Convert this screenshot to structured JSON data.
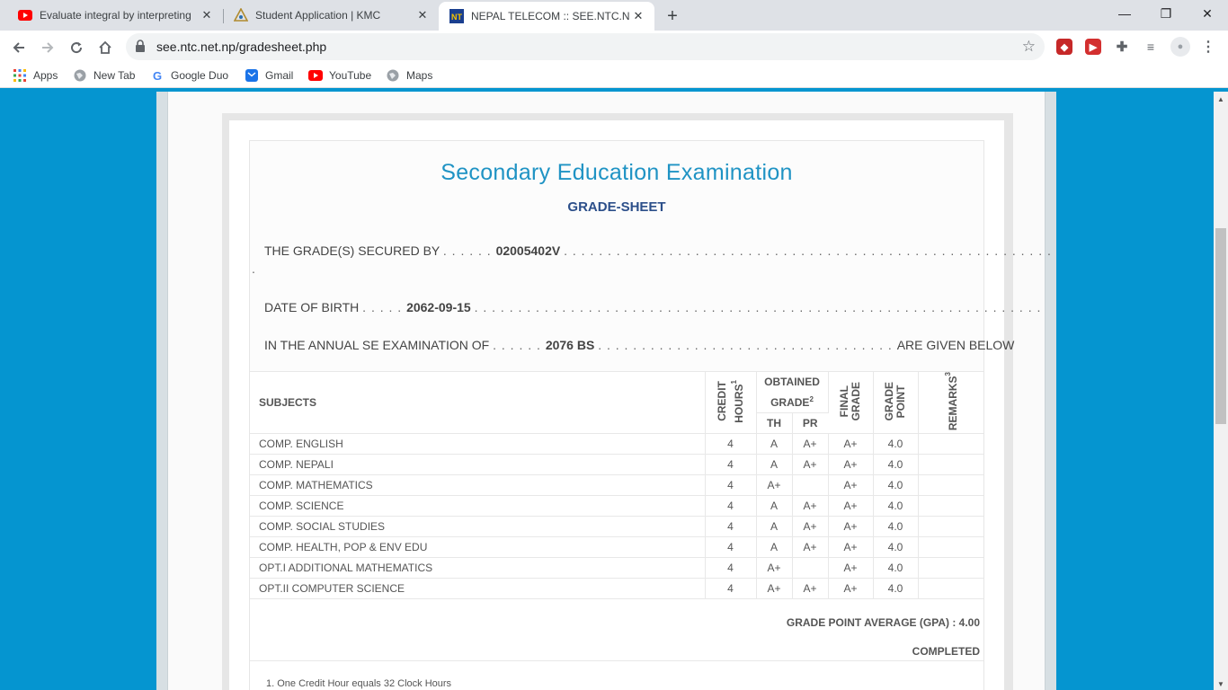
{
  "tabs": [
    {
      "title": "Evaluate integral by interpreting",
      "icon": "youtube-icon"
    },
    {
      "title": "Student Application | KMC",
      "icon": "kmc-logo-icon"
    },
    {
      "title": "NEPAL TELECOM :: SEE.NTC.NET.",
      "icon": "ntc-logo-icon"
    }
  ],
  "address_bar": {
    "url": "see.ntc.net.np/gradesheet.php"
  },
  "bookmarks": [
    {
      "label": "Apps",
      "icon": "apps-grid-icon"
    },
    {
      "label": "New Tab",
      "icon": "globe-icon"
    },
    {
      "label": "Google Duo",
      "icon": "google-icon"
    },
    {
      "label": "Gmail",
      "icon": "gmail-icon"
    },
    {
      "label": "YouTube",
      "icon": "youtube-icon"
    },
    {
      "label": "Maps",
      "icon": "globe-icon"
    }
  ],
  "sheet": {
    "title": "Secondary Education Examination",
    "subtitle": "GRADE-SHEET",
    "secured_by_label": "THE GRADE(S) SECURED BY",
    "secured_by_value": "02005402V",
    "dob_label": "DATE OF BIRTH",
    "dob_value": "2062-09-15",
    "exam_label": "IN THE ANNUAL SE EXAMINATION OF",
    "exam_value": "2076 BS",
    "exam_suffix": "ARE GIVEN BELOW"
  },
  "table": {
    "headers": {
      "subjects": "SUBJECTS",
      "credit_hours_1": "CREDIT",
      "credit_hours_2": "HOURS",
      "credit_sup": "1",
      "obtained_1": "OBTAINED",
      "obtained_2": "GRADE",
      "obtained_sup": "2",
      "th": "TH",
      "pr": "PR",
      "final_grade_1": "FINAL",
      "final_grade_2": "GRADE",
      "grade_point_1": "GRADE",
      "grade_point_2": "POINT",
      "remarks": "REMARKS",
      "remarks_sup": "3"
    },
    "rows": [
      {
        "subject": "COMP. ENGLISH",
        "credit": "4",
        "th": "A",
        "pr": "A+",
        "final": "A+",
        "gp": "4.0",
        "remarks": ""
      },
      {
        "subject": "COMP. NEPALI",
        "credit": "4",
        "th": "A",
        "pr": "A+",
        "final": "A+",
        "gp": "4.0",
        "remarks": ""
      },
      {
        "subject": "COMP. MATHEMATICS",
        "credit": "4",
        "th": "A+",
        "pr": "",
        "final": "A+",
        "gp": "4.0",
        "remarks": ""
      },
      {
        "subject": "COMP. SCIENCE",
        "credit": "4",
        "th": "A",
        "pr": "A+",
        "final": "A+",
        "gp": "4.0",
        "remarks": ""
      },
      {
        "subject": "COMP. SOCIAL STUDIES",
        "credit": "4",
        "th": "A",
        "pr": "A+",
        "final": "A+",
        "gp": "4.0",
        "remarks": ""
      },
      {
        "subject": "COMP. HEALTH, POP & ENV EDU",
        "credit": "4",
        "th": "A",
        "pr": "A+",
        "final": "A+",
        "gp": "4.0",
        "remarks": ""
      },
      {
        "subject": "OPT.I ADDITIONAL MATHEMATICS",
        "credit": "4",
        "th": "A+",
        "pr": "",
        "final": "A+",
        "gp": "4.0",
        "remarks": ""
      },
      {
        "subject": "OPT.II COMPUTER SCIENCE",
        "credit": "4",
        "th": "A+",
        "pr": "A+",
        "final": "A+",
        "gp": "4.0",
        "remarks": ""
      }
    ]
  },
  "summary": {
    "gpa": "GRADE POINT AVERAGE (GPA) : 4.00",
    "status": "COMPLETED"
  },
  "footnotes": [
    "1. One Credit Hour equals 32 Clock Hours"
  ],
  "colors": {
    "page_bg": "#0595d0",
    "title": "#1f93c4",
    "subtitle": "#2c4f8a"
  }
}
